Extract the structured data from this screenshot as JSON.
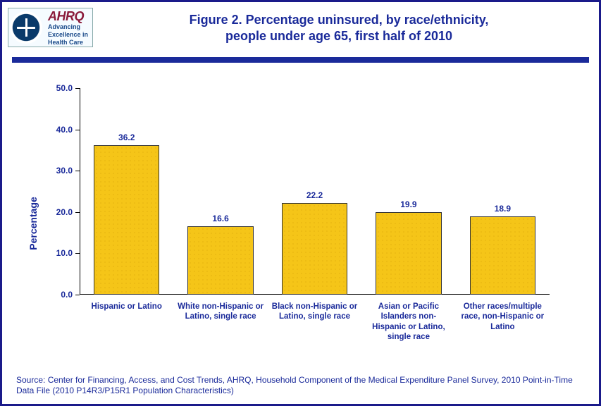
{
  "logo": {
    "brand": "AHRQ",
    "tag1": "Advancing",
    "tag2": "Excellence in",
    "tag3": "Health Care"
  },
  "title_line1": "Figure 2. Percentage uninsured, by race/ethnicity,",
  "title_line2": "people under age 65, first half of 2010",
  "chart_data": {
    "type": "bar",
    "ylabel": "Percentage",
    "xlabel": "",
    "ylim": [
      0,
      50
    ],
    "yticks": [
      0.0,
      10.0,
      20.0,
      30.0,
      40.0,
      50.0
    ],
    "categories": [
      "Hispanic or Latino",
      "White non-Hispanic or Latino, single race",
      "Black non-Hispanic or Latino, single race",
      "Asian or Pacific Islanders non-Hispanic or Latino, single race",
      "Other races/multiple race, non-Hispanic or Latino"
    ],
    "values": [
      36.2,
      16.6,
      22.2,
      19.9,
      18.9
    ],
    "title": "Figure 2. Percentage uninsured, by race/ethnicity, people under age 65, first half of 2010"
  },
  "source": "Source: Center for Financing, Access, and Cost Trends, AHRQ, Household Component of the Medical Expenditure Panel Survey, 2010 Point-in-Time Data File (2010 P14R3/P15R1 Population Characteristics)"
}
